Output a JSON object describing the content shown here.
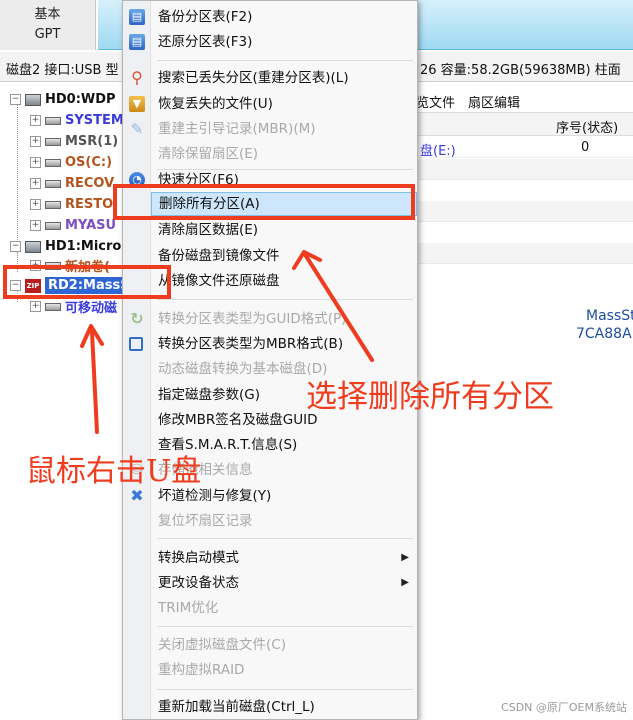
{
  "disk_type": {
    "line1": "基本",
    "line2": "GPT"
  },
  "info_bar": {
    "left": "磁盘2 接口:USB  型",
    "right": "26  容量:58.2GB(59638MB)  柱面"
  },
  "tree": {
    "hd0": "HD0:WDP",
    "hd0_parts": [
      {
        "label": "SYSTEM",
        "color": "#3b3bdc"
      },
      {
        "label": "MSR(1)",
        "color": "#555555"
      },
      {
        "label": "OS(C:)",
        "color": "#b5531c"
      },
      {
        "label": "RECOV",
        "color": "#b5531c"
      },
      {
        "label": "RESTO",
        "color": "#b5531c"
      },
      {
        "label": "MYASU",
        "color": "#7a4ec0"
      }
    ],
    "hd1": "HD1:Micro",
    "hd1_part": "新加卷(",
    "rd2": "RD2:MassS",
    "rd2_zip": "ZIP",
    "rd2_part": "可移动磁"
  },
  "right_pane": {
    "tab1": "览文件",
    "tab2": "扇区编辑",
    "col_seq": "序号(状态)",
    "row1_name": "盘(E:)",
    "row1_seq": "0",
    "bottom_line1": "MassSt",
    "bottom_line2": "7CA88A"
  },
  "menu": {
    "items": [
      {
        "label": "备份分区表(F2)",
        "disabled": false,
        "icon": "backup-table-icon"
      },
      {
        "label": "还原分区表(F3)",
        "disabled": false,
        "icon": "restore-table-icon"
      },
      {
        "label": "搜索已丢失分区(重建分区表)(L)",
        "disabled": false,
        "icon": "search-icon"
      },
      {
        "label": "恢复丢失的文件(U)",
        "disabled": false,
        "icon": "recover-files-icon"
      },
      {
        "label": "重建主引导记录(MBR)(M)",
        "disabled": true,
        "icon": "rebuild-mbr-icon"
      },
      {
        "label": "清除保留扇区(E)",
        "disabled": true
      },
      {
        "label": "快速分区(F6)",
        "disabled": false,
        "icon": "quick-partition-icon"
      },
      {
        "label": "删除所有分区(A)",
        "disabled": false,
        "highlighted": true
      },
      {
        "label": "清除扇区数据(E)",
        "disabled": false
      },
      {
        "label": "备份磁盘到镜像文件",
        "disabled": false
      },
      {
        "label": "从镜像文件还原磁盘",
        "disabled": false
      },
      {
        "label": "转换分区表类型为GUID格式(P)",
        "disabled": true,
        "icon": "convert-guid-icon"
      },
      {
        "label": "转换分区表类型为MBR格式(B)",
        "disabled": false,
        "icon": "convert-mbr-icon"
      },
      {
        "label": "动态磁盘转换为基本磁盘(D)",
        "disabled": true
      },
      {
        "label": "指定磁盘参数(G)",
        "disabled": false
      },
      {
        "label": "修改MBR签名及磁盘GUID",
        "disabled": false
      },
      {
        "label": "查看S.M.A.R.T.信息(S)",
        "disabled": false
      },
      {
        "label": "存储池相关信息",
        "disabled": true,
        "icon": "storage-pool-icon"
      },
      {
        "label": "坏道检测与修复(Y)",
        "disabled": false,
        "icon": "repair-tools-icon"
      },
      {
        "label": "复位坏扇区记录",
        "disabled": true
      },
      {
        "label": "转换启动模式",
        "disabled": false,
        "submenu": true
      },
      {
        "label": "更改设备状态",
        "disabled": false,
        "submenu": true
      },
      {
        "label": "TRIM优化",
        "disabled": true
      },
      {
        "label": "关闭虚拟磁盘文件(C)",
        "disabled": true
      },
      {
        "label": "重构虚拟RAID",
        "disabled": true
      },
      {
        "label": "重新加载当前磁盘(Ctrl_L)",
        "disabled": false
      }
    ]
  },
  "annotations": {
    "select_delete_all": "选择删除所有分区",
    "right_click_disk": "鼠标右击U盘",
    "color": "#f03c1e"
  },
  "watermark": "CSDN @原厂OEM系统站"
}
